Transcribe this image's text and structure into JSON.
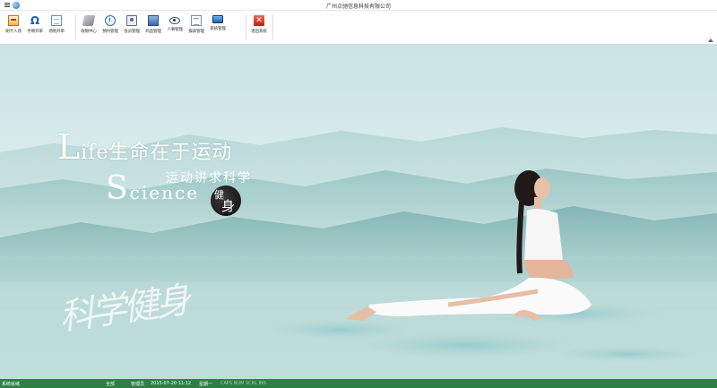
{
  "window": {
    "title": "广州点驰信息科技有限公司"
  },
  "toolbar": {
    "group1": [
      {
        "label": "刷卡入场",
        "icon": "card-icon"
      },
      {
        "label": "手牌开单",
        "icon": "omega-icon"
      },
      {
        "label": "场地开单",
        "icon": "document-icon"
      }
    ],
    "group2": [
      {
        "label": "收银中心",
        "icon": "hand-icon"
      },
      {
        "label": "预约管理",
        "icon": "clock-icon"
      },
      {
        "label": "会员管理",
        "icon": "member-card-icon"
      },
      {
        "label": "商品管理",
        "icon": "goods-icon"
      },
      {
        "label": "人事管理",
        "icon": "eye-icon"
      },
      {
        "label": "报表管理",
        "icon": "report-icon"
      },
      {
        "label": "系统管理",
        "icon": "monitor-icon"
      }
    ],
    "group3": [
      {
        "label": "退出系统",
        "icon": "exit-icon"
      }
    ]
  },
  "banner": {
    "line1_initial": "L",
    "line1_rest": "ife生命在于运动",
    "line2": "运动讲求科学",
    "line3_initial": "S",
    "line3_rest": "cience",
    "seal_top": "健",
    "seal_bottom": "身",
    "calligraphy": "科学健身"
  },
  "statusbar": {
    "status": "系统就绪",
    "scope": "全部",
    "user": "管理员",
    "datetime": "2015-07-20  11:12",
    "weekday": "星期一",
    "indicators": "CAPS  NUM  SCRL  INS"
  },
  "colors": {
    "statusbar_bg": "#2e7f45",
    "banner_water": "#b9dad7"
  }
}
